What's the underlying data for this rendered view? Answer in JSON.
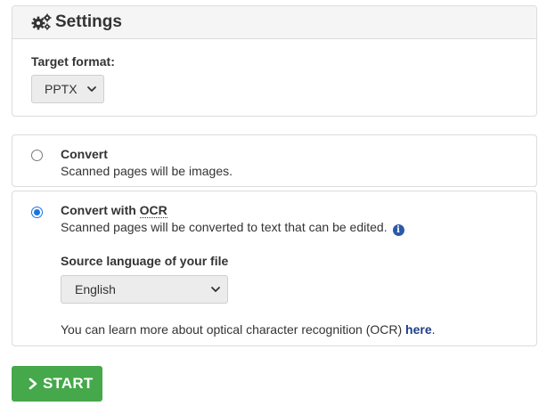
{
  "settings": {
    "title": "Settings",
    "icon": "gears-icon",
    "target_format_label": "Target format:",
    "target_format_value": "PPTX"
  },
  "options": {
    "convert": {
      "title": "Convert",
      "description": "Scanned pages will be images.",
      "selected": false
    },
    "ocr": {
      "title_prefix": "Convert with ",
      "title_abbr": "OCR",
      "description": "Scanned pages will be converted to text that can be edited.",
      "info_icon_glyph": "i",
      "selected": true,
      "source_language_label": "Source language of your file",
      "source_language_value": "English",
      "learn_more_text": "You can learn more about optical character recognition (OCR) ",
      "learn_more_link": "here",
      "learn_more_suffix": "."
    }
  },
  "start_button": {
    "label": "START",
    "color": "#45a84a"
  },
  "colors": {
    "accent_blue": "#1a73e8",
    "link": "#1f3f8a",
    "info_icon": "#2a5aa6"
  }
}
